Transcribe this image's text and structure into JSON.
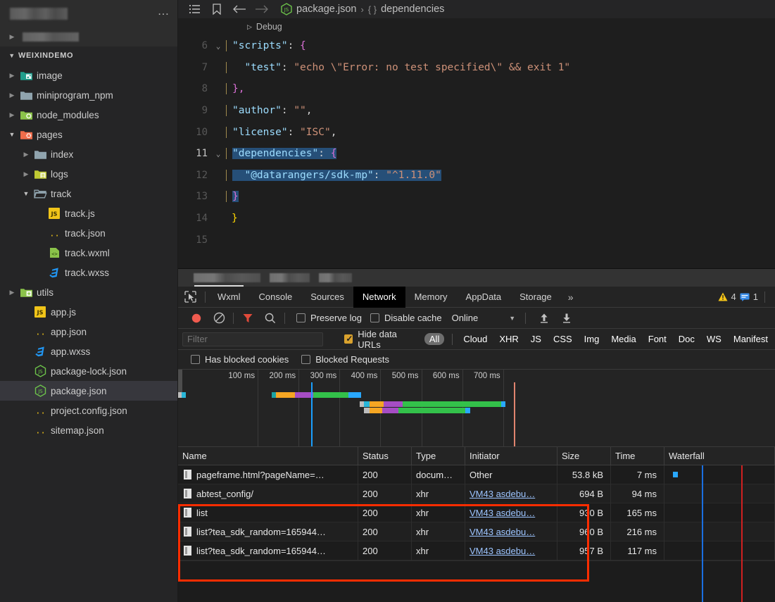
{
  "sidebar": {
    "more_icon": "…",
    "project_label": "WEIXINDEMO",
    "tree": [
      {
        "label": "image",
        "type": "folder",
        "icon": "folder-image-icon",
        "indent": 1,
        "twisty": "collapsed",
        "color": "#1f9e8c"
      },
      {
        "label": "miniprogram_npm",
        "type": "folder",
        "icon": "folder-icon",
        "indent": 1,
        "twisty": "collapsed",
        "color": "#90a4ae"
      },
      {
        "label": "node_modules",
        "type": "folder",
        "icon": "folder-node-icon",
        "indent": 1,
        "twisty": "collapsed",
        "color": "#8bc34a"
      },
      {
        "label": "pages",
        "type": "folder",
        "icon": "folder-pages-icon",
        "indent": 1,
        "twisty": "expanded",
        "color": "#ef6c4a"
      },
      {
        "label": "index",
        "type": "folder",
        "icon": "folder-icon",
        "indent": 2,
        "twisty": "collapsed",
        "color": "#90a4ae"
      },
      {
        "label": "logs",
        "type": "folder",
        "icon": "folder-log-icon",
        "indent": 2,
        "twisty": "collapsed",
        "color": "#c0ca33"
      },
      {
        "label": "track",
        "type": "folder",
        "icon": "folder-open-icon",
        "indent": 2,
        "twisty": "expanded",
        "color": "#90a4ae"
      },
      {
        "label": "track.js",
        "type": "file",
        "icon": "js-icon",
        "indent": 3,
        "twisty": "none",
        "color": "#f0c419"
      },
      {
        "label": "track.json",
        "type": "file",
        "icon": "json-icon",
        "indent": 3,
        "twisty": "none",
        "color": "#f0c419"
      },
      {
        "label": "track.wxml",
        "type": "file",
        "icon": "wxml-icon",
        "indent": 3,
        "twisty": "none",
        "color": "#8bc34a"
      },
      {
        "label": "track.wxss",
        "type": "file",
        "icon": "css-icon",
        "indent": 3,
        "twisty": "none",
        "color": "#2196f3"
      },
      {
        "label": "utils",
        "type": "folder",
        "icon": "folder-add-icon",
        "indent": 1,
        "twisty": "collapsed",
        "color": "#8bc34a"
      },
      {
        "label": "app.js",
        "type": "file",
        "icon": "js-icon",
        "indent": 2,
        "twisty": "none",
        "color": "#f0c419"
      },
      {
        "label": "app.json",
        "type": "file",
        "icon": "json-icon",
        "indent": 2,
        "twisty": "none",
        "color": "#f0c419"
      },
      {
        "label": "app.wxss",
        "type": "file",
        "icon": "css-icon",
        "indent": 2,
        "twisty": "none",
        "color": "#2196f3"
      },
      {
        "label": "package-lock.json",
        "type": "file",
        "icon": "npm-icon",
        "indent": 2,
        "twisty": "none",
        "color": "#6cc24a"
      },
      {
        "label": "package.json",
        "type": "file",
        "icon": "npm-icon",
        "indent": 2,
        "twisty": "none",
        "color": "#6cc24a",
        "selected": true
      },
      {
        "label": "project.config.json",
        "type": "file",
        "icon": "json-icon",
        "indent": 2,
        "twisty": "none",
        "color": "#f0c419"
      },
      {
        "label": "sitemap.json",
        "type": "file",
        "icon": "json-icon",
        "indent": 2,
        "twisty": "none",
        "color": "#f0c419"
      }
    ]
  },
  "breadcrumb": {
    "menu_icon": "list-icon",
    "bookmark_icon": "bookmark-icon",
    "back_icon": "arrow-left-icon",
    "forward_icon": "arrow-right-icon",
    "file_icon": "npm-icon",
    "file": "package.json",
    "sep": "›",
    "brace": "{ }",
    "symbol": "dependencies"
  },
  "debug_bar": {
    "label": "Debug",
    "triangle": "▷"
  },
  "editor": {
    "lines": [
      {
        "num": "6",
        "fold": "⌄",
        "segments": [
          {
            "t": "\"scripts\"",
            "c": "k"
          },
          {
            "t": ": ",
            "c": "p"
          },
          {
            "t": "{",
            "c": "b"
          }
        ]
      },
      {
        "num": "7",
        "fold": "",
        "segments": [
          {
            "t": "  \"test\"",
            "c": "k"
          },
          {
            "t": ": ",
            "c": "p"
          },
          {
            "t": "\"echo \\\"Error: no test specified\\\" && exit 1\"",
            "c": "s"
          }
        ]
      },
      {
        "num": "8",
        "fold": "",
        "segments": [
          {
            "t": "},",
            "c": "b"
          }
        ]
      },
      {
        "num": "9",
        "fold": "",
        "segments": [
          {
            "t": "\"author\"",
            "c": "k"
          },
          {
            "t": ": ",
            "c": "p"
          },
          {
            "t": "\"\"",
            "c": "s"
          },
          {
            "t": ",",
            "c": "p"
          }
        ]
      },
      {
        "num": "10",
        "fold": "",
        "segments": [
          {
            "t": "\"license\"",
            "c": "k"
          },
          {
            "t": ": ",
            "c": "p"
          },
          {
            "t": "\"ISC\"",
            "c": "s"
          },
          {
            "t": ",",
            "c": "p"
          }
        ]
      },
      {
        "num": "11",
        "fold": "⌄",
        "segments": [
          {
            "t": "\"dependencies\"",
            "c": "k"
          },
          {
            "t": ": ",
            "c": "p"
          },
          {
            "t": "{",
            "c": "b"
          }
        ]
      },
      {
        "num": "12",
        "fold": "",
        "segments": [
          {
            "t": "  \"@datarangers/sdk-mp\"",
            "c": "k"
          },
          {
            "t": ": ",
            "c": "p"
          },
          {
            "t": "\"^1.11.0\"",
            "c": "s"
          }
        ]
      },
      {
        "num": "13",
        "fold": "",
        "segments": [
          {
            "t": "}",
            "c": "b"
          }
        ]
      },
      {
        "num": "14",
        "fold": "",
        "segments": [
          {
            "t": "}",
            "c": "b2"
          }
        ]
      },
      {
        "num": "15",
        "fold": "",
        "segments": []
      }
    ]
  },
  "devtools": {
    "cursor_icon": "inspect-cursor-icon",
    "tabs": [
      {
        "label": "Wxml",
        "active": false
      },
      {
        "label": "Console",
        "active": false
      },
      {
        "label": "Sources",
        "active": false
      },
      {
        "label": "Network",
        "active": true
      },
      {
        "label": "Memory",
        "active": false
      },
      {
        "label": "AppData",
        "active": false
      },
      {
        "label": "Storage",
        "active": false
      }
    ],
    "more": "»",
    "warning_icon": "warning-triangle-icon",
    "warning_count": "4",
    "message_icon": "message-icon",
    "message_count": "1"
  },
  "network_toolbar": {
    "record_icon": "record-circle-icon",
    "clear_icon": "clear-no-entry-icon",
    "filter_icon": "funnel-icon",
    "search_icon": "search-icon",
    "preserve_log": {
      "label": "Preserve log",
      "checked": false
    },
    "disable_cache": {
      "label": "Disable cache",
      "checked": false
    },
    "throttling": {
      "value": "Online",
      "caret": "▼"
    },
    "import_icon": "upload-arrow-icon",
    "export_icon": "download-arrow-icon"
  },
  "filter_bar": {
    "filter_placeholder": "Filter",
    "filter_value": "",
    "hide_data_urls": {
      "label": "Hide data URLs",
      "checked": true
    },
    "chips": [
      {
        "label": "All",
        "active": true
      },
      {
        "label": "Cloud",
        "active": false
      },
      {
        "label": "XHR",
        "active": false
      },
      {
        "label": "JS",
        "active": false
      },
      {
        "label": "CSS",
        "active": false
      },
      {
        "label": "Img",
        "active": false
      },
      {
        "label": "Media",
        "active": false
      },
      {
        "label": "Font",
        "active": false
      },
      {
        "label": "Doc",
        "active": false
      },
      {
        "label": "WS",
        "active": false
      },
      {
        "label": "Manifest",
        "active": false
      }
    ]
  },
  "block_bar": {
    "has_blocked_cookies": {
      "label": "Has blocked cookies",
      "checked": false
    },
    "blocked_requests": {
      "label": "Blocked Requests",
      "checked": false
    }
  },
  "overview": {
    "ticks": [
      "100 ms",
      "200 ms",
      "300 ms",
      "400 ms",
      "500 ms",
      "600 ms",
      "700 ms"
    ],
    "domcontentloaded_color": "#1a9fff",
    "load_color": "#e0846e"
  },
  "table": {
    "columns": [
      "Name",
      "Status",
      "Type",
      "Initiator",
      "Size",
      "Time",
      "Waterfall"
    ],
    "rows": [
      {
        "name": "pageframe.html?pageName=…",
        "status": "200",
        "type": "docum…",
        "initiator": "Other",
        "initiator_link": false,
        "size": "53.8 kB",
        "time": "7 ms"
      },
      {
        "name": "abtest_config/",
        "status": "200",
        "type": "xhr",
        "initiator": "VM43 asdebu…",
        "initiator_link": true,
        "size": "694 B",
        "time": "94 ms"
      },
      {
        "name": "list",
        "status": "200",
        "type": "xhr",
        "initiator": "VM43 asdebu…",
        "initiator_link": true,
        "size": "930 B",
        "time": "165 ms"
      },
      {
        "name": "list?tea_sdk_random=165944…",
        "status": "200",
        "type": "xhr",
        "initiator": "VM43 asdebu…",
        "initiator_link": true,
        "size": "960 B",
        "time": "216 ms"
      },
      {
        "name": "list?tea_sdk_random=165944…",
        "status": "200",
        "type": "xhr",
        "initiator": "VM43 asdebu…",
        "initiator_link": true,
        "size": "957 B",
        "time": "117 ms"
      }
    ]
  },
  "annotation": {
    "highlight_color": "#ff2d00"
  }
}
